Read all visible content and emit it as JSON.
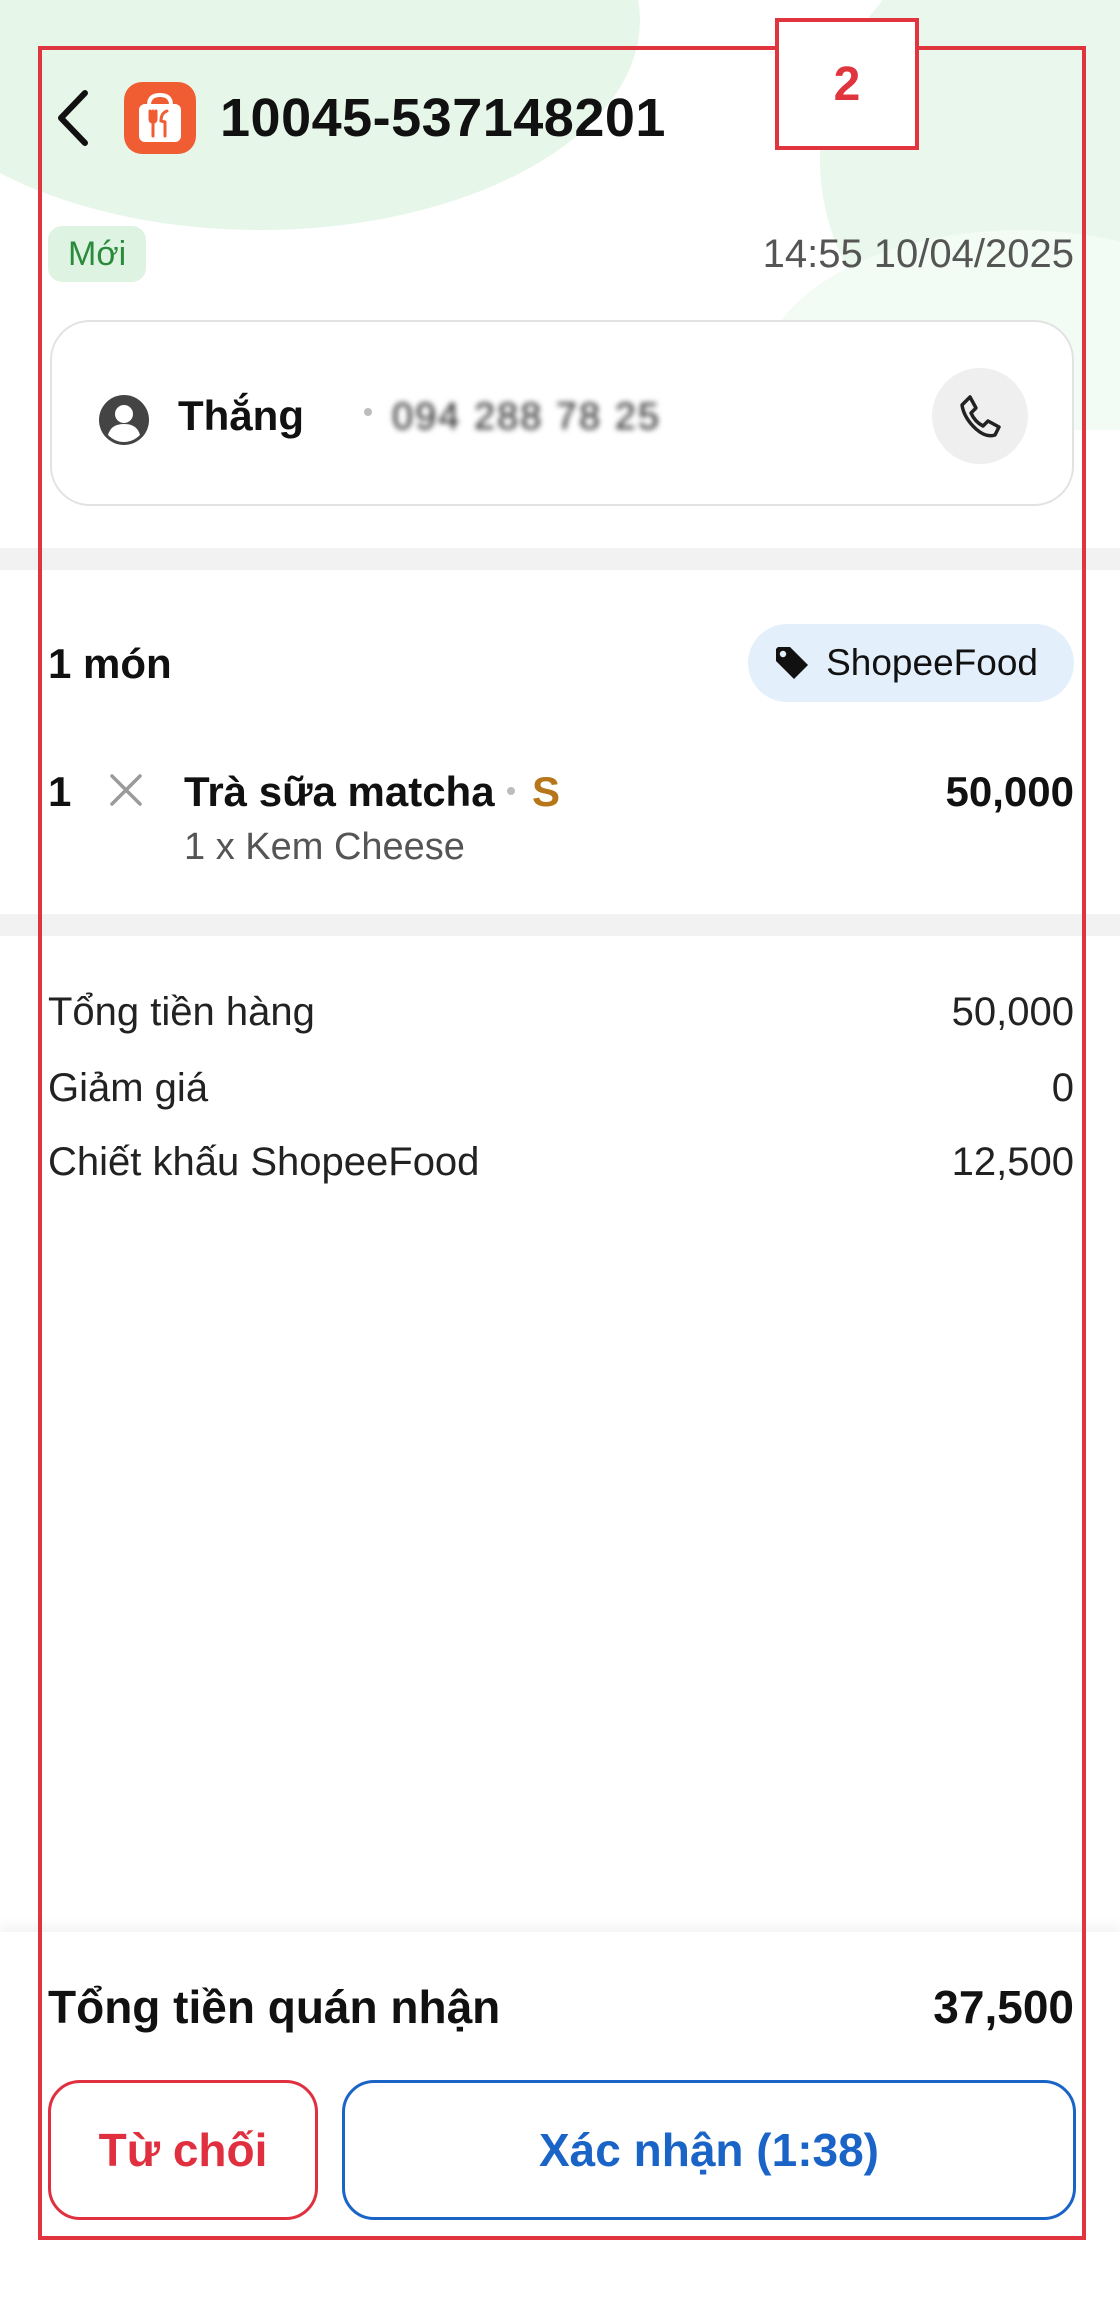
{
  "header": {
    "order_id": "10045-537148201"
  },
  "order_meta": {
    "status": "Mới",
    "time": "14:55 10/04/2025"
  },
  "customer": {
    "name": "Thắng",
    "phone": "094 288 78 25"
  },
  "items_section": {
    "count_label": "1 món",
    "platform": "ShopeeFood"
  },
  "items": [
    {
      "qty": "1",
      "name": "Trà sữa matcha",
      "size": "S",
      "option": "1 x Kem Cheese",
      "price": "50,000"
    }
  ],
  "summary": {
    "subtotal_label": "Tổng tiền hàng",
    "subtotal_value": "50,000",
    "discount_label": "Giảm giá",
    "discount_value": "0",
    "commission_label": "Chiết khấu ShopeeFood",
    "commission_value": "12,500"
  },
  "footer": {
    "total_label": "Tổng tiền quán nhận",
    "total_value": "37,500",
    "reject_label": "Từ chối",
    "confirm_label": "Xác nhận (1:38)"
  },
  "annotation": {
    "label": "2",
    "color": "#e0353f"
  },
  "colors": {
    "brand_orange": "#f05d33",
    "status_green": "#2a8c3b",
    "reject_red": "#e0303f",
    "confirm_blue": "#1a64c8",
    "size_accent": "#b8761a"
  },
  "icons": [
    "back-arrow-icon",
    "shopeefood-logo-icon",
    "user-icon",
    "phone-icon",
    "tag-icon",
    "times-icon"
  ]
}
